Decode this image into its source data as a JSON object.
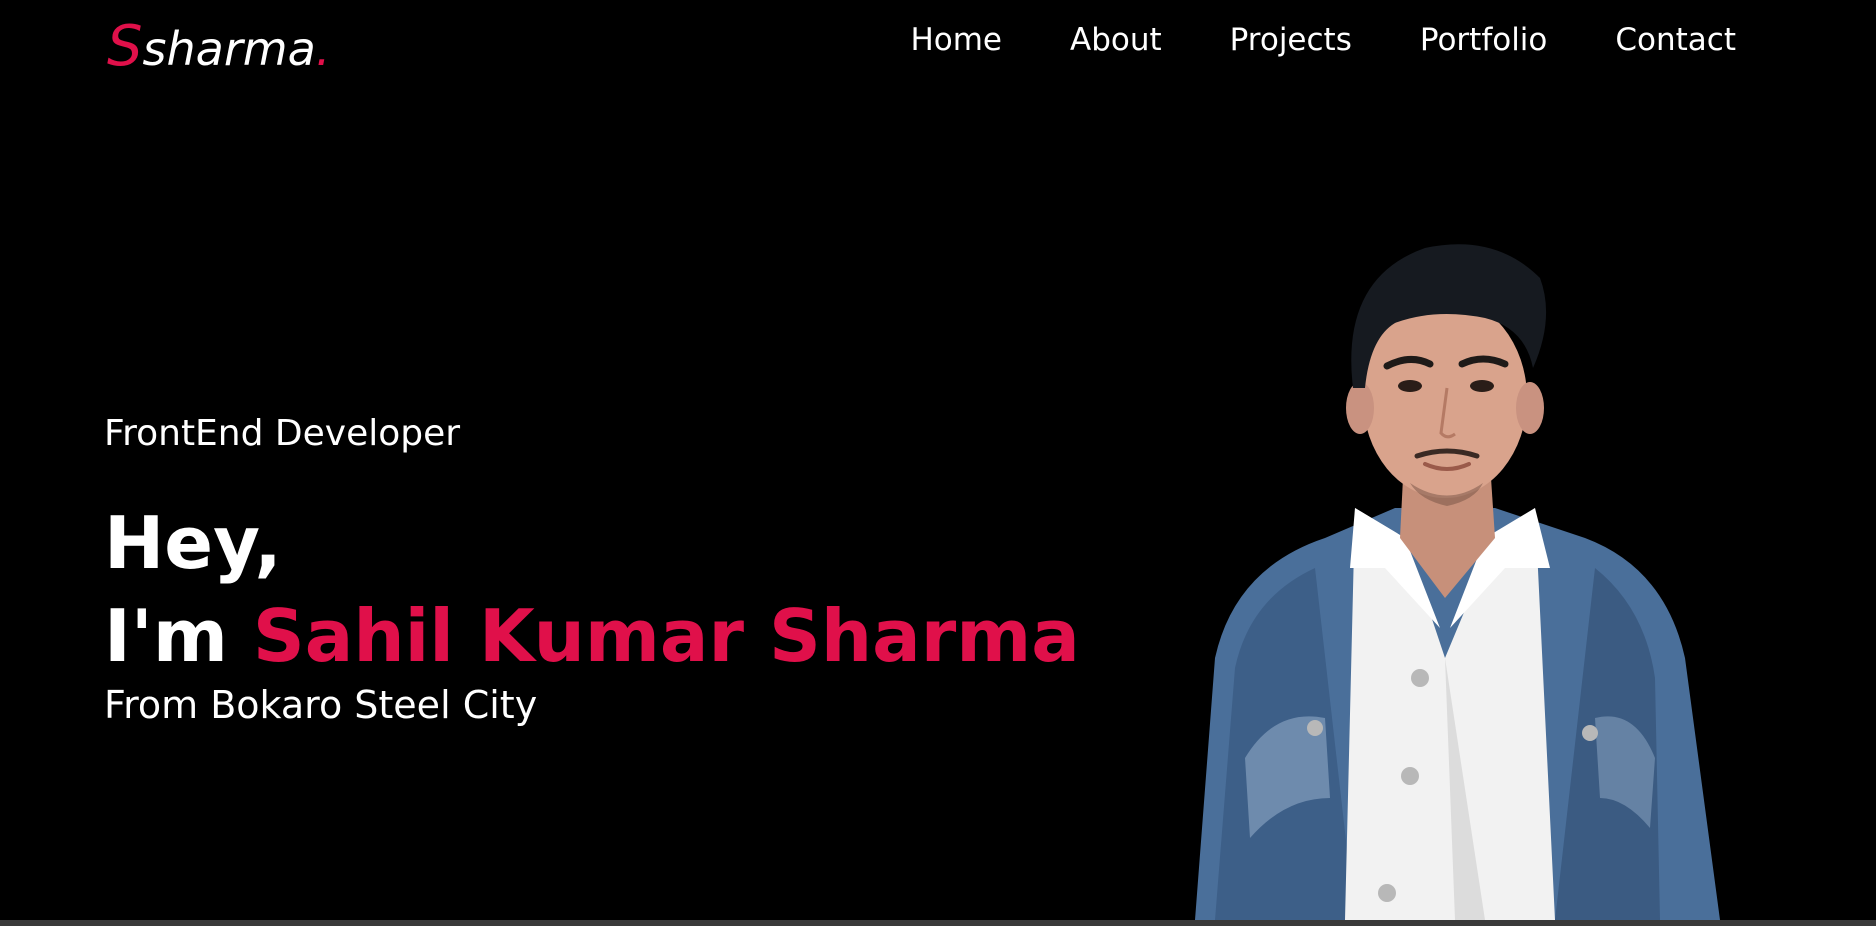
{
  "logo": {
    "initial": "S",
    "rest": "sharma",
    "dot": "."
  },
  "nav": {
    "items": [
      {
        "label": "Home"
      },
      {
        "label": "About"
      },
      {
        "label": "Projects"
      },
      {
        "label": "Portfolio"
      },
      {
        "label": "Contact"
      }
    ]
  },
  "hero": {
    "role": "FrontEnd Developer",
    "greeting": "Hey,",
    "intro_prefix": "I'm ",
    "name": "Sahil Kumar Sharma",
    "location": "From Bokaro Steel City"
  },
  "colors": {
    "background": "#000000",
    "accent": "#e0104a",
    "text": "#ffffff"
  }
}
